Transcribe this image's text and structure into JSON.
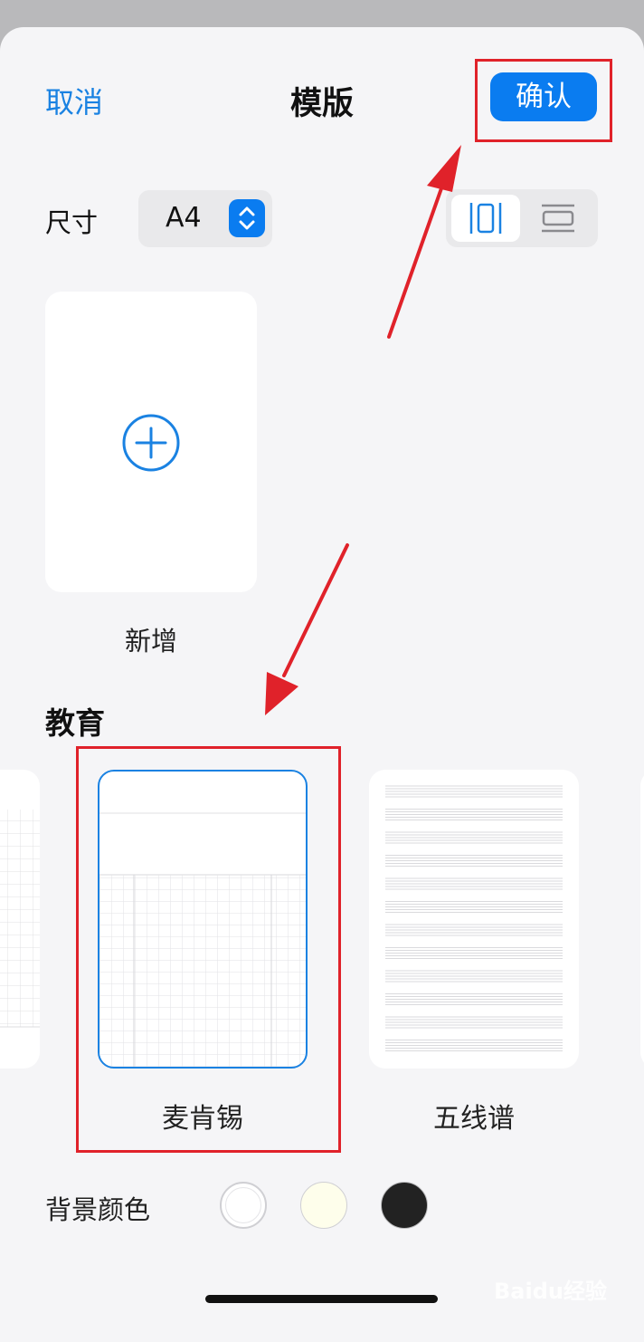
{
  "header": {
    "cancel_label": "取消",
    "title": "模版",
    "confirm_label": "确认"
  },
  "size": {
    "label": "尺寸",
    "value": "A4"
  },
  "orientation": {
    "selected": "portrait"
  },
  "add_template": {
    "label": "新增"
  },
  "section": {
    "title": "教育"
  },
  "templates": [
    {
      "label": "",
      "style": "grid"
    },
    {
      "label": "麦肯锡",
      "style": "mckinsey",
      "selected": true
    },
    {
      "label": "五线谱",
      "style": "staff"
    }
  ],
  "background": {
    "label": "背景颜色",
    "colors": [
      "#ffffff",
      "#fefeeb",
      "#222222"
    ]
  },
  "watermark": "Baidu经验",
  "colors": {
    "accent": "#0a7cf0",
    "link": "#1a82e2",
    "annotation": "#e0222a"
  }
}
